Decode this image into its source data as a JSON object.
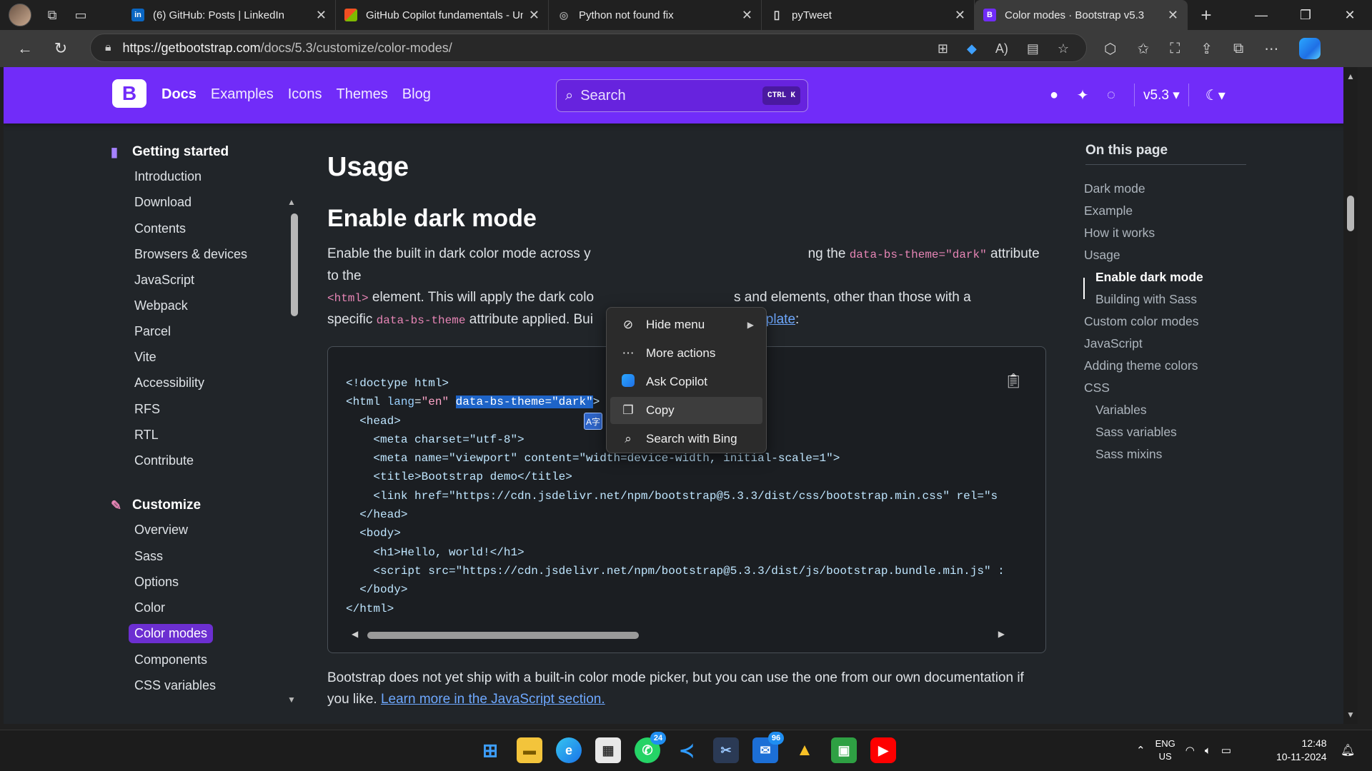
{
  "browser": {
    "tabs": [
      {
        "title": "(6) GitHub: Posts | LinkedIn",
        "favicon": "in",
        "favicon_color": "#0a66c2"
      },
      {
        "title": "GitHub Copilot fundamentals - Un",
        "favicon": "ms",
        "favicon_color": "#f25022"
      },
      {
        "title": "Python not found fix",
        "favicon": "◎",
        "favicon_color": "#555555"
      },
      {
        "title": "pyTweet",
        "favicon": "▯",
        "favicon_color": "#2b2b2b"
      },
      {
        "title": "Color modes · Bootstrap v5.3",
        "favicon": "B",
        "favicon_color": "#712cf9"
      }
    ],
    "url_host": "https://getbootstrap.com",
    "url_path": "/docs/5.3/customize/color-modes/"
  },
  "bootstrap": {
    "logo": "B",
    "nav_links": {
      "docs": "Docs",
      "examples": "Examples",
      "icons": "Icons",
      "themes": "Themes",
      "blog": "Blog"
    },
    "search_placeholder": "Search",
    "search_kbd": {
      "ctrl": "CTRL",
      "key": "K"
    },
    "version": "v5.3",
    "accent": "#712cf9"
  },
  "sidebar": {
    "getting_started": {
      "title": "Getting started",
      "items": [
        "Introduction",
        "Download",
        "Contents",
        "Browsers & devices",
        "JavaScript",
        "Webpack",
        "Parcel",
        "Vite",
        "Accessibility",
        "RFS",
        "RTL",
        "Contribute"
      ]
    },
    "customize": {
      "title": "Customize",
      "items": [
        "Overview",
        "Sass",
        "Options",
        "Color",
        "Color modes",
        "Components",
        "CSS variables"
      ],
      "active": "Color modes"
    }
  },
  "main": {
    "h1": "Usage",
    "h2": "Enable dark mode",
    "para1": {
      "t1": "Enable the built in dark color mode across y",
      "t2": "ng the ",
      "c1": "data-bs-theme=\"dark\"",
      "t3": " attribute to the",
      "c2": "<html>",
      "t4": " element. This will apply the dark colo",
      "t5": "s and elements, other than those with a",
      "t6": "specific ",
      "c3": "data-bs-theme",
      "t7": " attribute applied. Bui",
      "link": "mplate",
      "t8": ":"
    },
    "code_lines": [
      "<!doctype html>",
      "<html lang=\"en\" data-bs-theme=\"dark\">",
      "  <head>",
      "    <meta charset=\"utf-8\">",
      "    <meta name=\"viewport\" content=\"width=device-width, initial-scale=1\">",
      "    <title>Bootstrap demo</title>",
      "    <link href=\"https://cdn.jsdelivr.net/npm/bootstrap@5.3.3/dist/css/bootstrap.min.css\" rel=\"s",
      "  </head>",
      "  <body>",
      "    <h1>Hello, world!</h1>",
      "    <script src=\"https://cdn.jsdelivr.net/npm/bootstrap@5.3.3/dist/js/bootstrap.bundle.min.js\" :",
      "  </body>",
      "</html>"
    ],
    "para2": {
      "text": "Bootstrap does not yet ship with a built-in color mode picker, but you can use the one from our own documentation if you like. ",
      "link": "Learn more in the JavaScript section."
    }
  },
  "toc": {
    "title": "On this page",
    "items": [
      "Dark mode",
      "Example",
      "How it works",
      "Usage",
      "Enable dark mode",
      "Building with Sass",
      "Custom color modes",
      "JavaScript",
      "Adding theme colors",
      "CSS",
      "Variables",
      "Sass variables",
      "Sass mixins"
    ],
    "active": "Enable dark mode"
  },
  "context_menu": {
    "items": [
      {
        "label": "Hide menu",
        "icon": "eye-off-icon"
      },
      {
        "label": "More actions",
        "icon": "more-icon"
      },
      {
        "label": "Ask Copilot",
        "icon": "copilot-icon"
      },
      {
        "label": "Copy",
        "icon": "copy-icon"
      },
      {
        "label": "Search with Bing",
        "icon": "search-icon"
      }
    ]
  },
  "taskbar": {
    "whatsapp_badge": "24",
    "mail_badge": "96",
    "lang_top": "ENG",
    "lang_bottom": "US",
    "time": "12:48",
    "date": "10-11-2024"
  }
}
